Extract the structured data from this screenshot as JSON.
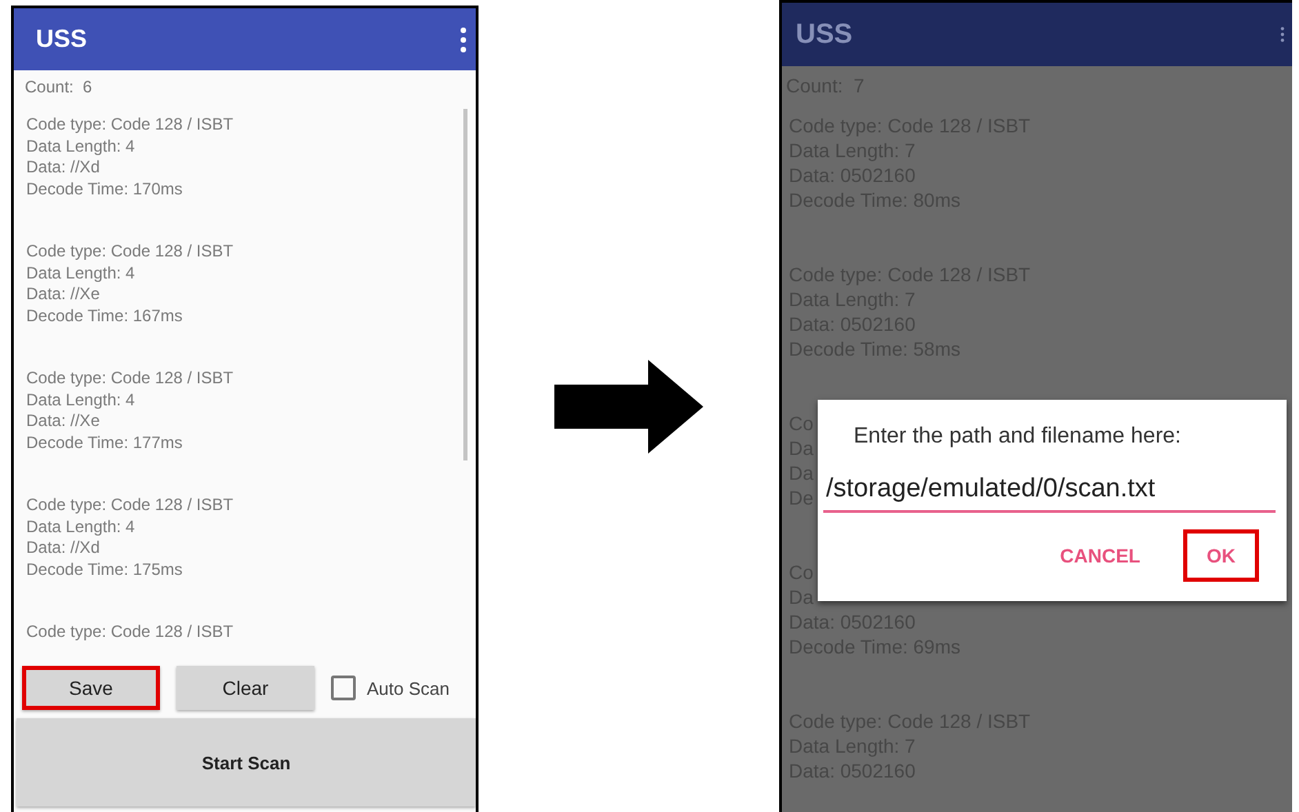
{
  "screens": [
    {
      "kind": "main",
      "dimmed": false,
      "title": "USS",
      "count_label": "Count:",
      "count": "6",
      "records": [
        {
          "lines": [
            "Code type: Code 128 / ISBT",
            "Data Length: 4",
            "Data: //Xd",
            "Decode Time: 170ms"
          ]
        },
        {
          "lines": [
            "Code type: Code 128 / ISBT",
            "Data Length: 4",
            "Data: //Xe",
            "Decode Time: 167ms"
          ]
        },
        {
          "lines": [
            "Code type: Code 128 / ISBT",
            "Data Length: 4",
            "Data: //Xe",
            "Decode Time: 177ms"
          ]
        },
        {
          "lines": [
            "Code type: Code 128 / ISBT",
            "Data Length: 4",
            "Data: //Xd",
            "Decode Time: 175ms"
          ]
        },
        {
          "lines": [
            "Code type: Code 128 / ISBT"
          ]
        }
      ],
      "buttons": [
        {
          "label": "Save",
          "highlighted": true
        },
        {
          "label": "Clear",
          "highlighted": false
        }
      ],
      "checkbox": {
        "label": "Auto Scan",
        "checked": false
      },
      "scan_button": "Start Scan"
    },
    {
      "kind": "dialog",
      "dimmed": true,
      "title": "USS",
      "count_label": "Count:",
      "count": "7",
      "records": [
        {
          "lines": [
            "Code type: Code 128 / ISBT",
            "Data Length: 7",
            "Data: 0502160",
            "Decode Time: 80ms"
          ]
        },
        {
          "lines": [
            "Code type: Code 128 / ISBT",
            "Data Length: 7",
            "Data: 0502160",
            "Decode Time: 58ms"
          ]
        },
        {
          "lines": [
            "Co",
            "Da",
            "Da",
            "De"
          ]
        },
        {
          "lines": [
            "Co",
            "Da",
            "Data: 0502160",
            "Decode Time: 69ms"
          ]
        },
        {
          "lines": [
            "Code type: Code 128 / ISBT",
            "Data Length: 7",
            "Data: 0502160"
          ]
        }
      ],
      "dialog": {
        "message": "Enter the path and filename here:",
        "path": "/storage/emulated/0/scan.txt",
        "buttons": [
          {
            "label": "CANCEL",
            "highlighted": false
          },
          {
            "label": "OK",
            "highlighted": true
          }
        ]
      }
    }
  ]
}
